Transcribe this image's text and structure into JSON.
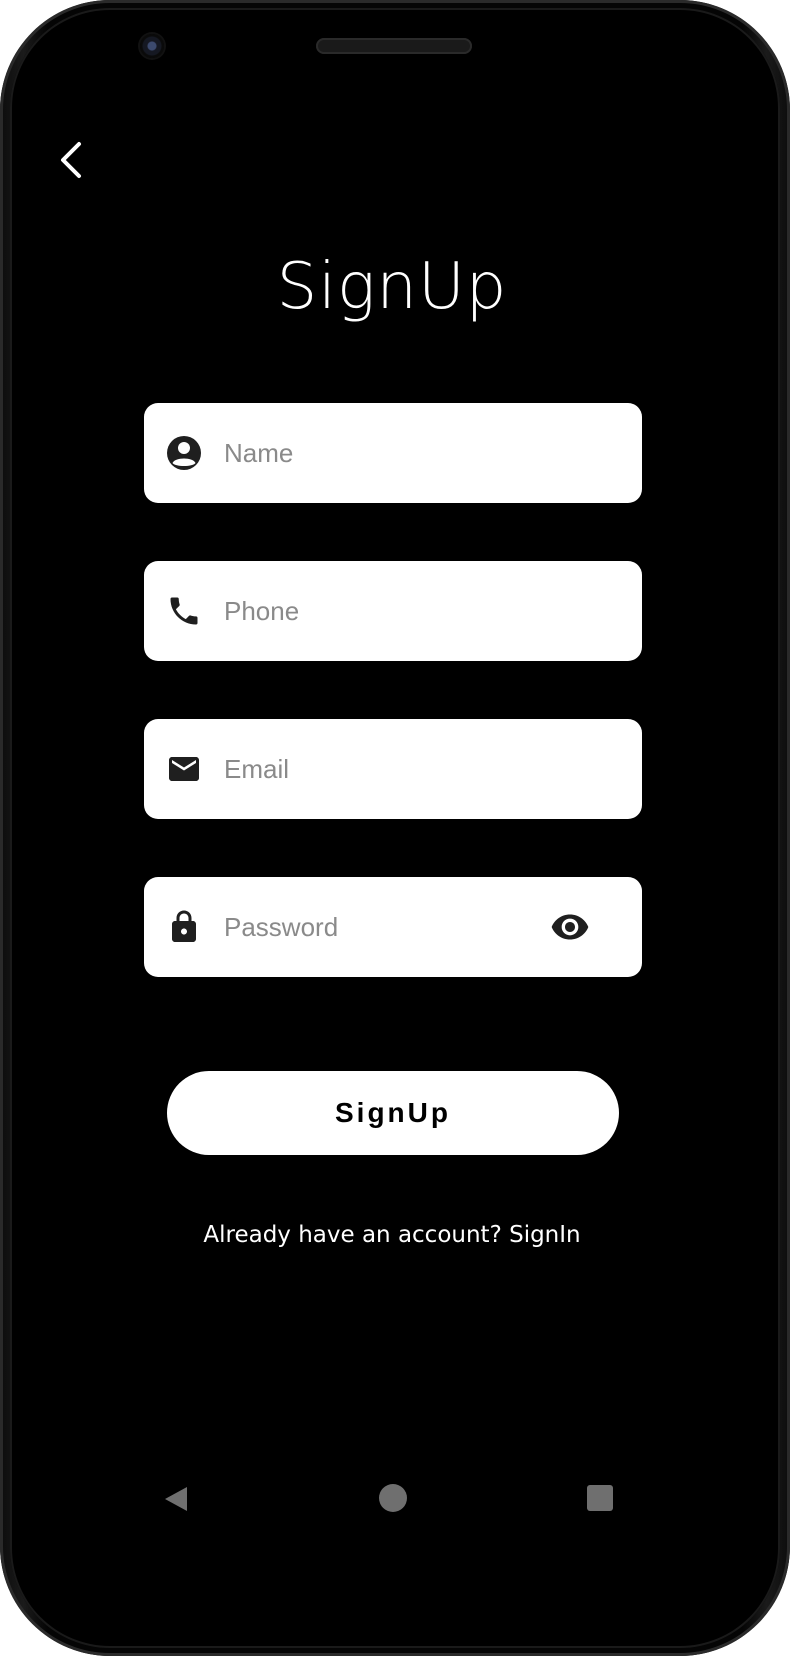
{
  "screen": {
    "title": "SignUp",
    "fields": {
      "name": {
        "placeholder": "Name",
        "icon": "account-circle-icon"
      },
      "phone": {
        "placeholder": "Phone",
        "icon": "phone-icon"
      },
      "email": {
        "placeholder": "Email",
        "icon": "mail-icon"
      },
      "password": {
        "placeholder": "Password",
        "icon": "lock-icon",
        "toggle_icon": "eye-icon"
      }
    },
    "signup_button": "SignUp",
    "signin_link": "Already have an account? SignIn"
  },
  "navigation": {
    "back_icon": "chevron-left-icon",
    "system_nav": [
      "nav-back-icon",
      "nav-home-icon",
      "nav-recents-icon"
    ]
  },
  "colors": {
    "background": "#000000",
    "field_background": "#ffffff",
    "placeholder": "#8a8a8a",
    "icon": "#1f1f1f",
    "text": "#ffffff",
    "nav_icons": "#6f6f6f"
  }
}
